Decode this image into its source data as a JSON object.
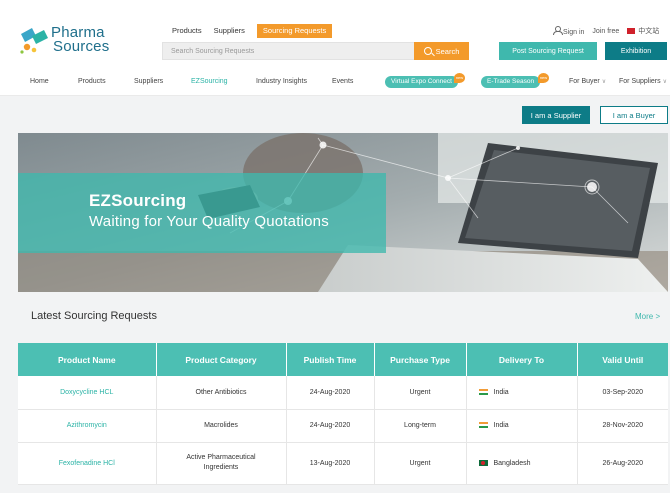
{
  "brand": {
    "line1": "Pharma",
    "line2": "Sources"
  },
  "top_tabs": [
    {
      "label": "Products"
    },
    {
      "label": "Suppliers"
    },
    {
      "label": "Sourcing Requests"
    }
  ],
  "search": {
    "placeholder": "Search Sourcing Requests",
    "button_label": "Search"
  },
  "account": {
    "sign_in": "Sign in",
    "join_free": "Join free",
    "language": "中文站"
  },
  "header_buttons": {
    "post_request": "Post Sourcing Request",
    "exhibition": "Exhibition"
  },
  "nav": {
    "home": "Home",
    "products": "Products",
    "suppliers": "Suppliers",
    "ezsourcing": "EZSourcing",
    "industry_insights": "Industry Insights",
    "events": "Events",
    "virtual_expo": "Virtual Expo Connect",
    "etrade": "E-Trade Season",
    "new_tag": "new",
    "for_buyer": "For Buyer",
    "for_suppliers": "For Suppliers"
  },
  "role_buttons": {
    "supplier": "I am a Supplier",
    "buyer": "I am a Buyer"
  },
  "banner": {
    "title": "EZSourcing",
    "subtitle": "Waiting for Your Quality Quotations"
  },
  "section": {
    "title": "Latest Sourcing Requests",
    "more": "More >"
  },
  "table": {
    "headers": [
      "Product Name",
      "Product Category",
      "Publish Time",
      "Purchase Type",
      "Delivery To",
      "Valid Until"
    ],
    "rows": [
      {
        "product": "Doxycycline HCL",
        "category": "Other Antibiotics",
        "published": "24-Aug-2020",
        "type": "Urgent",
        "country": "India",
        "valid": "03-Sep-2020"
      },
      {
        "product": "Azithromycin",
        "category": "Macrolides",
        "published": "24-Aug-2020",
        "type": "Long-term",
        "country": "India",
        "valid": "28-Nov-2020"
      },
      {
        "product": "Fexofenadine HCl",
        "category": "Active Pharmaceutical Ingredients",
        "published": "13-Aug-2020",
        "type": "Urgent",
        "country": "Bangladesh",
        "valid": "26-Aug-2020"
      }
    ]
  },
  "colors": {
    "teal": "#4cbfb3",
    "dark_teal": "#0d7c87",
    "orange": "#f39a2b",
    "logo_blue": "#1f6f8b"
  }
}
